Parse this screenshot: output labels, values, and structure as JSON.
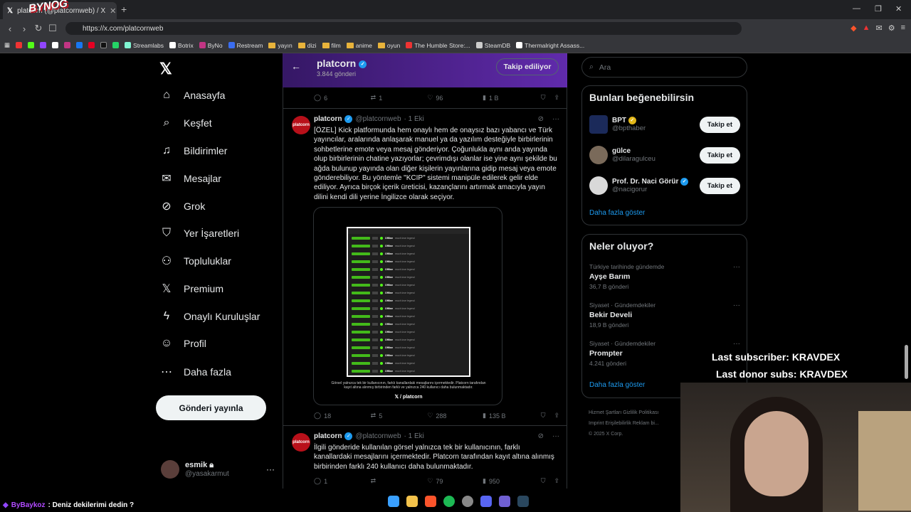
{
  "browser": {
    "tab_title": "platcorn (@platcornweb) / X",
    "url": "https://x.com/platcornweb",
    "bookmarks": [
      "Streamlabs",
      "Botrix",
      "ByNo",
      "Restream",
      "yayın",
      "dizi",
      "film",
      "anime",
      "oyun",
      "The Humble Store:...",
      "SteamDB",
      "Thermalright Assass..."
    ]
  },
  "overlay_logo": "BYNOG",
  "nav": {
    "items": [
      {
        "label": "Anasayfa",
        "icon": "home-icon"
      },
      {
        "label": "Keşfet",
        "icon": "search-icon"
      },
      {
        "label": "Bildirimler",
        "icon": "bell-icon"
      },
      {
        "label": "Mesajlar",
        "icon": "mail-icon"
      },
      {
        "label": "Grok",
        "icon": "grok-icon"
      },
      {
        "label": "Yer İşaretleri",
        "icon": "bookmark-icon"
      },
      {
        "label": "Topluluklar",
        "icon": "people-icon"
      },
      {
        "label": "Premium",
        "icon": "x-icon"
      },
      {
        "label": "Onaylı Kuruluşlar",
        "icon": "lightning-icon"
      },
      {
        "label": "Profil",
        "icon": "person-icon"
      },
      {
        "label": "Daha fazla",
        "icon": "more-icon"
      }
    ],
    "post_button": "Gönderi yayınla",
    "user": {
      "name": "esmik",
      "handle": "@yasakarmut"
    }
  },
  "profile_header": {
    "name": "platcorn",
    "posts": "3.844 gönderi",
    "follow_state": "Takip ediliyor"
  },
  "prev_actions": {
    "replies": "6",
    "reposts": "1",
    "likes": "96",
    "views": "1 B"
  },
  "tweets": [
    {
      "name": "platcorn",
      "handle": "@platcornweb",
      "time": "· 1 Eki",
      "text": "[ÖZEL] Kick platformunda hem onaylı hem de onaysız bazı yabancı ve Türk yayıncılar, aralarında anlaşarak manuel ya da yazılım desteğiyle birbirlerinin sohbetlerine emote veya mesaj gönderiyor. Çoğunlukla aynı anda yayında olup birbirlerinin chatine yazıyorlar; çevrimdışı olanlar ise yine aynı şekilde bu ağda bulunup yayında olan diğer kişilerin yayınlarına gidip mesaj veya emote gönderebiliyor. Bu yöntemle \"KCIP\" sistemi manipüle edilerek gelir elde ediliyor. Ayrıca birçok içerik üreticisi, kazançlarını artırmak amacıyla yayın dilini kendi dili yerine İngilizce olarak seçiyor.",
      "media_caption": "Görsel yalnızca tek bir kullanıcının, farklı kanallardaki mesajlarını içermektedir. Platcorn tarafından kayıt altına alınmış birbirinden farklı ve yalnızca 240 kullanıcı daha bulunmaktadır.",
      "media_brand": "𝕏 / platcorn",
      "chat_status": "Offline",
      "chat_msg": "much love legend",
      "actions": {
        "replies": "18",
        "reposts": "5",
        "likes": "288",
        "views": "135 B"
      }
    },
    {
      "name": "platcorn",
      "handle": "@platcornweb",
      "time": "· 1 Eki",
      "text": "İlgili gönderide kullanılan görsel yalnızca tek bir kullanıcının, farklı kanallardaki mesajlarını içermektedir. Platcorn tarafından kayıt altına alınmış birbirinden farklı 240 kullanıcı daha bulunmaktadır.",
      "actions": {
        "replies": "1",
        "reposts": "",
        "likes": "79",
        "views": "950"
      }
    }
  ],
  "search": {
    "placeholder": "Ara"
  },
  "who_to_follow": {
    "title": "Bunları beğenebilirsin",
    "items": [
      {
        "name": "BPT",
        "handle": "@bpthaber",
        "button": "Takip et"
      },
      {
        "name": "gülce",
        "handle": "@dilaragulceu",
        "button": "Takip et"
      },
      {
        "name": "Prof. Dr. Naci Görür",
        "handle": "@nacigorur",
        "button": "Takip et"
      }
    ],
    "show_more": "Daha fazla göster"
  },
  "trends": {
    "title": "Neler oluyor?",
    "items": [
      {
        "context": "Türkiye tarihinde gündemde",
        "name": "Ayşe Barım",
        "posts": "36,7 B gönderi"
      },
      {
        "context": "Siyaset · Gündemdekiler",
        "name": "Bekir Develi",
        "posts": "18,9 B gönderi"
      },
      {
        "context": "Siyaset · Gündemdekiler",
        "name": "Prompter",
        "posts": "4.241 gönderi"
      }
    ],
    "show_more": "Daha fazla göster"
  },
  "footer": {
    "line1": "Hizmet Şartları   Gizlilik Politikası",
    "line2": "Imprint   Erişilebilirlik   Reklam bi...",
    "line3": "© 2025 X Corp."
  },
  "stream": {
    "last_subscriber": "Last subscriber: KRAVDEX",
    "last_donor": "Last donor subs: KRAVDEX",
    "chat_user": "ByBaykoz",
    "chat_message": ": Deniz dekilerimi dedin ?"
  }
}
